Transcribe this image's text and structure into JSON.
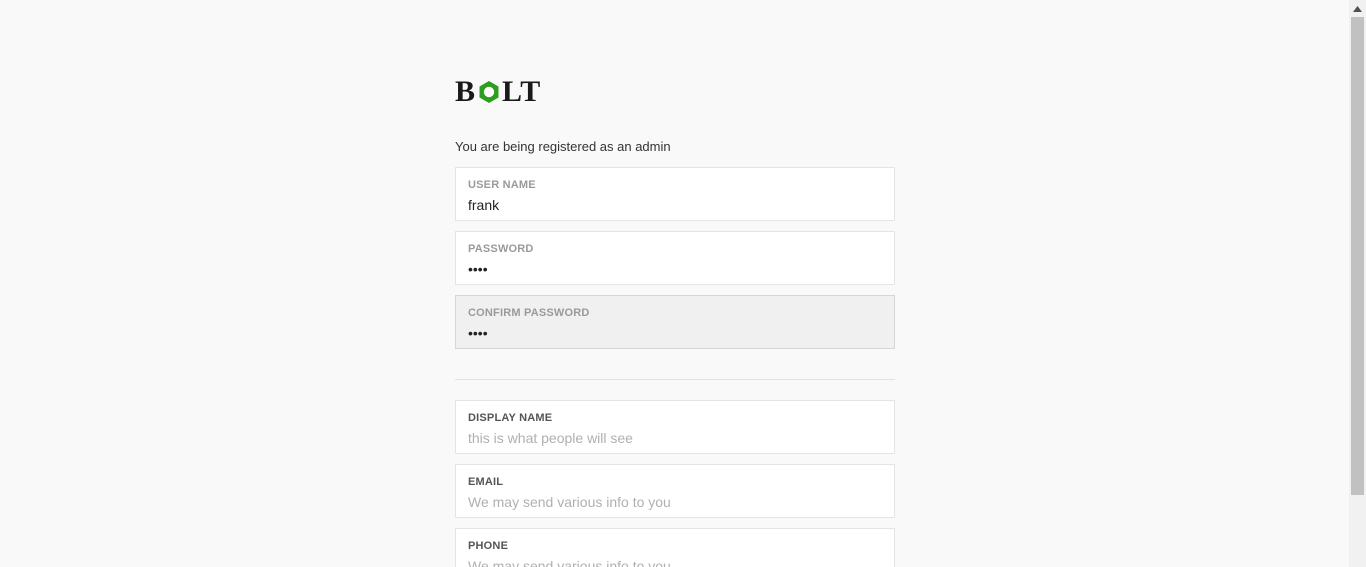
{
  "brand": {
    "logo_left": "B",
    "logo_right": "LT",
    "nut_color": "#2e9e1f"
  },
  "intro_text": "You are being registered as an admin",
  "fields": {
    "username": {
      "label": "USER NAME",
      "value": "frank",
      "placeholder": ""
    },
    "password": {
      "label": "PASSWORD",
      "value": "frnk",
      "placeholder": ""
    },
    "confirm_password": {
      "label": "CONFIRM PASSWORD",
      "value": "frnk",
      "placeholder": ""
    },
    "display_name": {
      "label": "DISPLAY NAME",
      "value": "",
      "placeholder": "this is what people will see"
    },
    "email": {
      "label": "EMAIL",
      "value": "",
      "placeholder": "We may send various info to you"
    },
    "phone": {
      "label": "PHONE",
      "value": "",
      "placeholder": "We may send various info to you"
    }
  }
}
